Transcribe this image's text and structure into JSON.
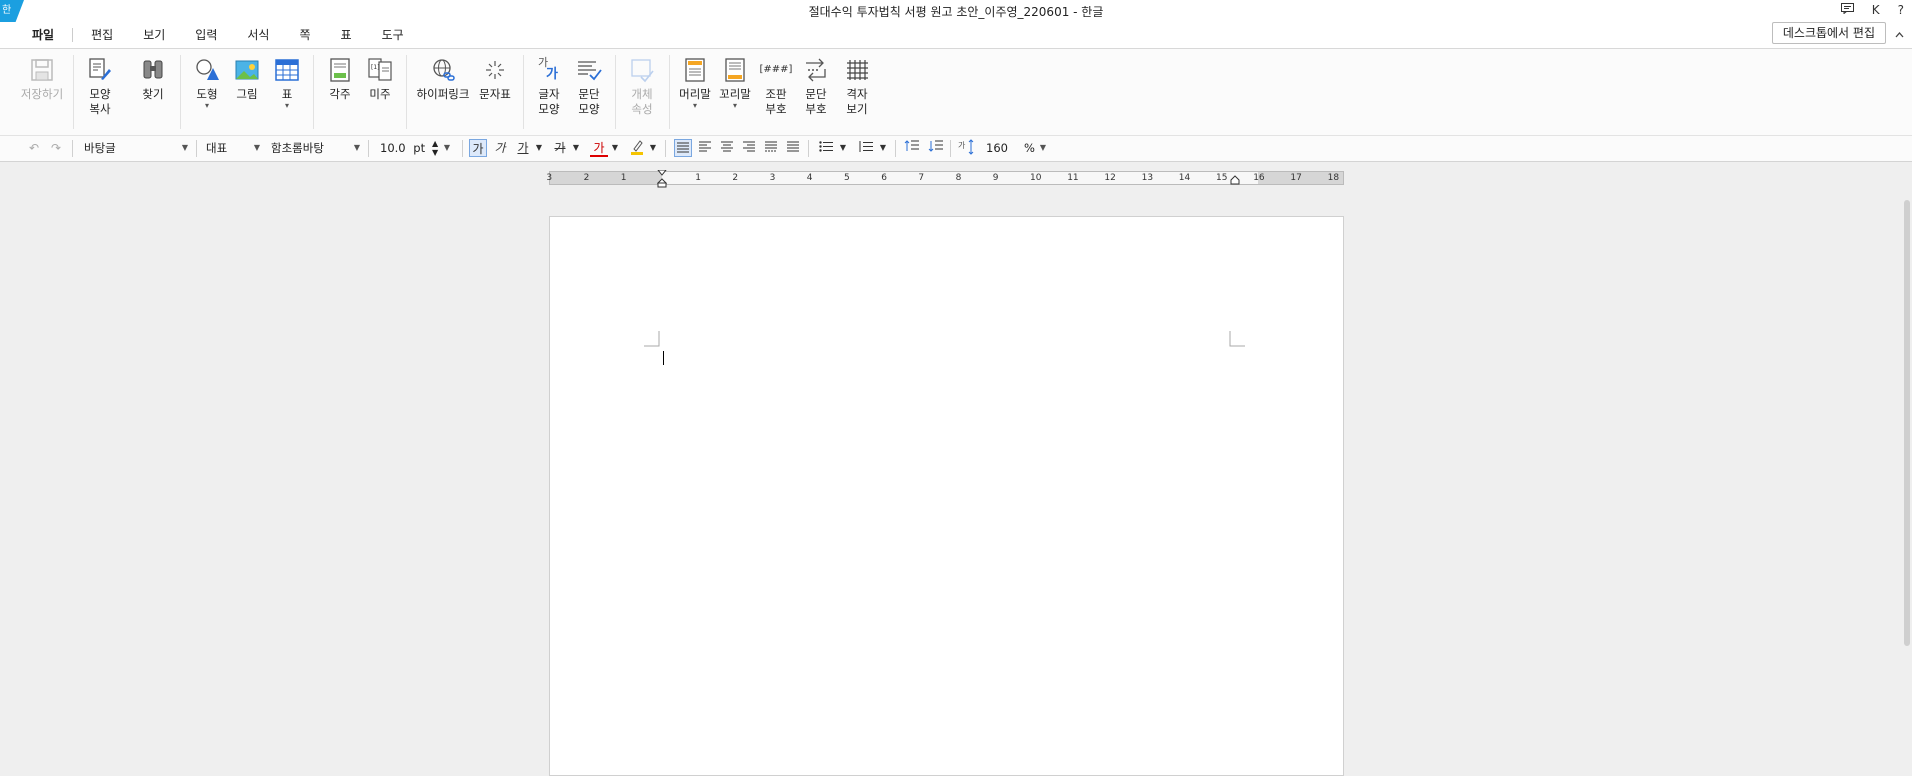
{
  "window": {
    "title": "절대수익 투자법칙 서평 원고 초안_이주영_220601 - 한글",
    "badge": "한",
    "user_initial": "K",
    "help": "?"
  },
  "menu": {
    "items": [
      "파일",
      "편집",
      "보기",
      "입력",
      "서식",
      "쪽",
      "표",
      "도구"
    ],
    "desktop_edit": "데스크톱에서 편집"
  },
  "ribbon": {
    "save": "저장하기",
    "format_copy_1": "모양",
    "format_copy_2": "복사",
    "find": "찾기",
    "shape": "도형",
    "picture": "그림",
    "table": "표",
    "footnote": "각주",
    "endnote": "미주",
    "hyperlink": "하이퍼링크",
    "symbol": "문자표",
    "char_shape_1": "글자",
    "char_shape_2": "모양",
    "para_shape_1": "문단",
    "para_shape_2": "모양",
    "object_props_1": "개체",
    "object_props_2": "속성",
    "header": "머리말",
    "footer": "꼬리말",
    "markup_1": "조판",
    "markup_2": "부호",
    "para_mark_1": "문단",
    "para_mark_2": "부호",
    "grid_1": "격자",
    "grid_2": "보기",
    "symbol_icon_text": "[###]",
    "char_icon_top": "가",
    "char_icon_bottom": "가"
  },
  "format": {
    "style": "바탕글",
    "lang": "대표",
    "font": "함초롬바탕",
    "size": "10.0",
    "size_unit": "pt",
    "bold_glyph": "가",
    "italic_glyph": "가",
    "underline_glyph": "가",
    "strike_glyph": "가",
    "color_glyph": "가",
    "line_spacing": "160",
    "line_spacing_unit": "%"
  },
  "ruler": {
    "labels": [
      "3",
      "2",
      "1",
      "1",
      "2",
      "3",
      "4",
      "5",
      "6",
      "7",
      "8",
      "9",
      "10",
      "11",
      "12",
      "13",
      "14",
      "15",
      "16",
      "17",
      "18"
    ]
  },
  "colors": {
    "accent": "#1b9fe0",
    "ribbon_bg": "#fbfbfb",
    "workspace_bg": "#efefef",
    "page_bg": "#ffffff"
  }
}
